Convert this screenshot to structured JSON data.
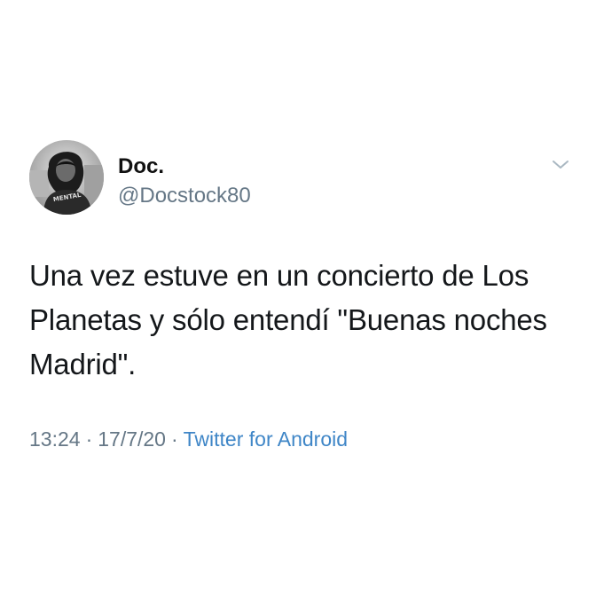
{
  "author": {
    "display_name": "Doc.",
    "handle": "@Docstock80",
    "avatar_shirt_text": "MENTAL"
  },
  "tweet": {
    "text": "Una vez estuve en un concierto de Los Planetas y sólo entendí \"Buenas noches Madrid\".",
    "time": "13:24",
    "date": "17/7/20",
    "separator": "·",
    "source": "Twitter for Android"
  },
  "icons": {
    "menu": "chevron-down-icon"
  },
  "colors": {
    "text": "#14171a",
    "secondary": "#657786",
    "link": "#3f86c7",
    "background": "#ffffff"
  }
}
